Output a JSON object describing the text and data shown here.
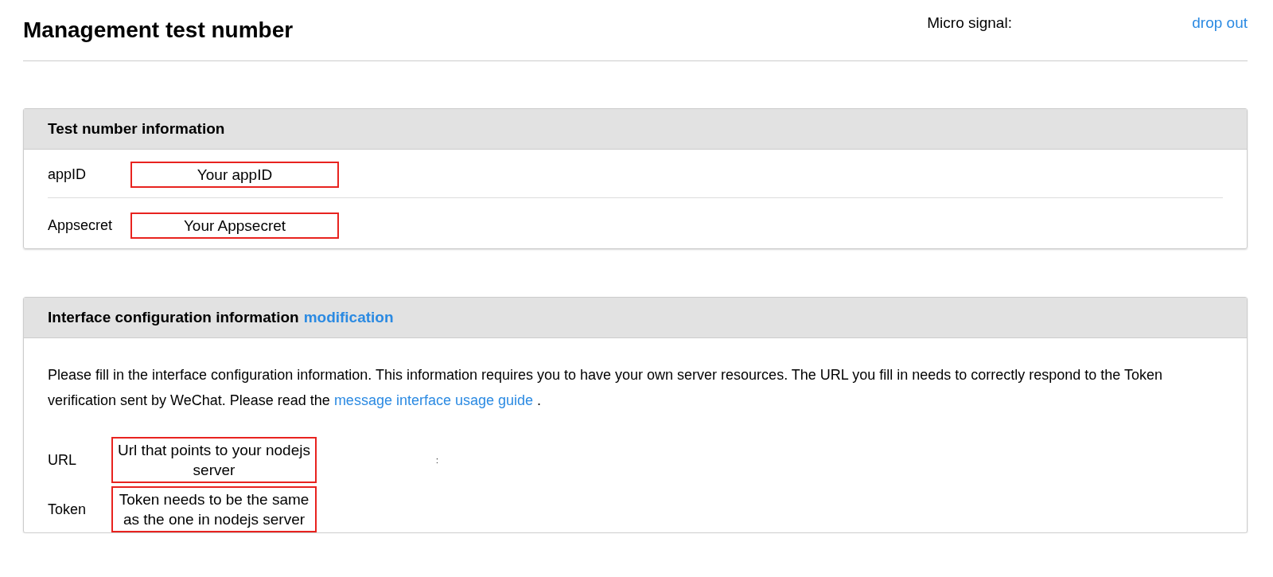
{
  "header": {
    "title": "Management test number",
    "micro_signal_label": "Micro signal:",
    "logout_link": "drop out"
  },
  "test_info": {
    "title": "Test number information",
    "fields": [
      {
        "label": "appID",
        "value": "Your appID"
      },
      {
        "label": "Appsecret",
        "value": "Your Appsecret"
      }
    ]
  },
  "interface_config": {
    "title": "Interface configuration information",
    "edit_link": "modification",
    "description": "Please fill in the interface configuration information. This information requires you to have your own server resources. The URL you fill in needs to correctly respond to the Token verification sent by WeChat. Please read the",
    "guide_link": "message interface usage guide",
    "description_end": ".",
    "fields": [
      {
        "label": "URL",
        "value": "Url that points to your nodejs server"
      },
      {
        "label": "Token",
        "value": "Token needs to be the same as the one in nodejs server"
      }
    ],
    "stray_mark": ":"
  }
}
